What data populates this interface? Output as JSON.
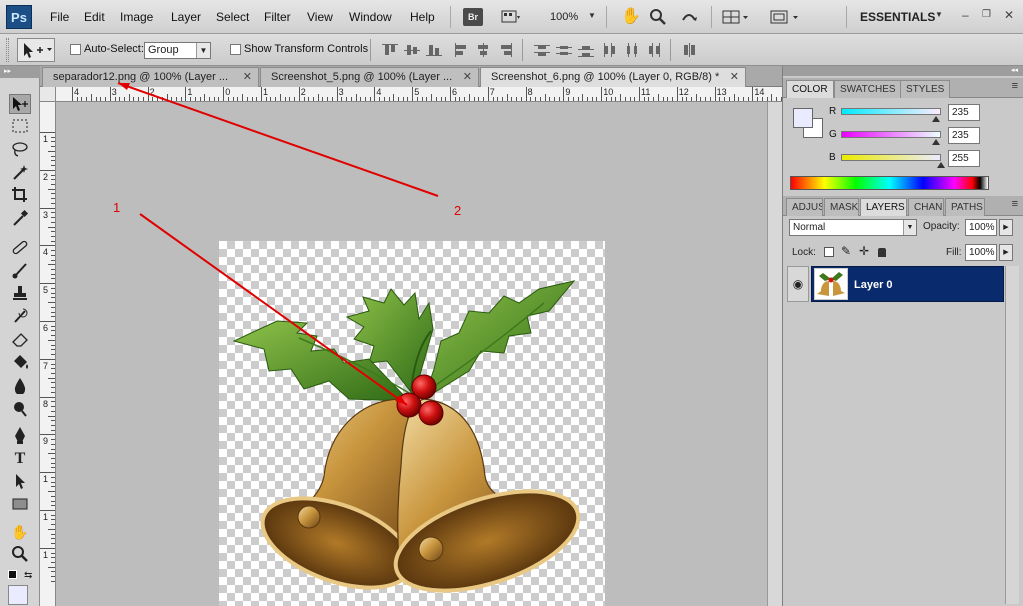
{
  "app": {
    "logo": "Ps"
  },
  "menu": [
    "File",
    "Edit",
    "Image",
    "Layer",
    "Select",
    "Filter",
    "View",
    "Window",
    "Help"
  ],
  "menubar_extras": {
    "bridge_label": "Br",
    "zoom": "100%",
    "workspace": "ESSENTIALS"
  },
  "options_bar": {
    "auto_select_label": "Auto-Select:",
    "auto_select_value": "Group",
    "show_transform_label": "Show Transform Controls"
  },
  "tabs": [
    {
      "label": "separador12.png @ 100% (Layer ...",
      "active": false
    },
    {
      "label": "Screenshot_5.png @ 100% (Layer ...",
      "active": false
    },
    {
      "label": "Screenshot_6.png @ 100% (Layer 0, RGB/8) *",
      "active": true
    }
  ],
  "rulers": {
    "top": [
      "4",
      "3",
      "2",
      "1",
      "0",
      "1",
      "2",
      "3",
      "4",
      "5",
      "6",
      "7",
      "8",
      "9",
      "10",
      "11",
      "12",
      "13",
      "14"
    ],
    "left": [
      "1",
      "2",
      "3",
      "4",
      "5",
      "6",
      "7",
      "8",
      "9",
      "1",
      "1",
      "1"
    ]
  },
  "annotations": {
    "label_1": "1",
    "label_2": "2"
  },
  "panels": {
    "color_tabs": [
      "COLOR",
      "SWATCHES",
      "STYLES"
    ],
    "color": {
      "channels": [
        {
          "label": "R",
          "value": "235",
          "gradient": "#00ffff"
        },
        {
          "label": "G",
          "value": "235",
          "gradient": "#ff00ff"
        },
        {
          "label": "B",
          "value": "255",
          "gradient": "#ffff00"
        }
      ],
      "foreground": "#ebebff",
      "background": "#ffffff"
    },
    "layer_tabs": [
      "ADJUS",
      "MASK",
      "LAYERS",
      "CHAN",
      "PATHS"
    ],
    "layers": {
      "blend_mode": "Normal",
      "opacity_label": "Opacity:",
      "opacity": "100%",
      "lock_label": "Lock:",
      "fill_label": "Fill:",
      "fill": "100%",
      "items": [
        {
          "name": "Layer 0",
          "visible": true,
          "selected": true
        }
      ]
    }
  },
  "colors": {
    "annotation": "#e00000",
    "layer_selected": "#0a2a6e"
  }
}
